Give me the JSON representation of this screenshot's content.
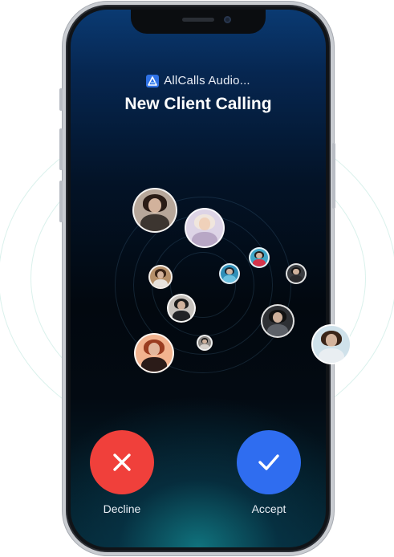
{
  "notification": {
    "app_name": "AllCalls Audio...",
    "app_icon": "allcalls-logo-icon",
    "title": "New Client Calling"
  },
  "actions": {
    "decline_label": "Decline",
    "decline_color": "#f0403b",
    "accept_label": "Accept",
    "accept_color": "#2f6df0"
  },
  "avatars": [
    {
      "name": "avatar-woman-dark-hair",
      "bg": "#b7a79a",
      "hair": "#2a1c16",
      "body": "#3c3530"
    },
    {
      "name": "avatar-woman-blonde",
      "bg": "#ddd4e6",
      "hair": "#f0e6dd",
      "body": "#b8a7c5"
    },
    {
      "name": "avatar-man-red-shirt",
      "bg": "#3fa6c8",
      "hair": "#1d1d1d",
      "body": "#d6344a"
    },
    {
      "name": "avatar-man-beard",
      "bg": "#3a3c40",
      "hair": "#141414",
      "body": "#2a2a2d"
    },
    {
      "name": "avatar-woman-smiling",
      "bg": "#b6906a",
      "hair": "#3b2416",
      "body": "#e8e2dc"
    },
    {
      "name": "avatar-man-blue-jacket",
      "bg": "#2f8fb8",
      "hair": "#1b2a36",
      "body": "#6bc1e0"
    },
    {
      "name": "avatar-man-standing",
      "bg": "#c7c2bd",
      "hair": "#1c1c1c",
      "body": "#222326"
    },
    {
      "name": "avatar-man-suit",
      "bg": "#2e3034",
      "hair": "#121212",
      "body": "#5d6168"
    },
    {
      "name": "avatar-woman-red-hair",
      "bg": "#f2b38f",
      "hair": "#9a3c20",
      "body": "#2b1b18"
    },
    {
      "name": "avatar-small-person",
      "bg": "#8e8a86",
      "hair": "#1a1a1a",
      "body": "#d8d2cc"
    },
    {
      "name": "avatar-man-incoming",
      "bg": "#cfe1ea",
      "hair": "#3a2418",
      "body": "#e9eef2"
    }
  ]
}
